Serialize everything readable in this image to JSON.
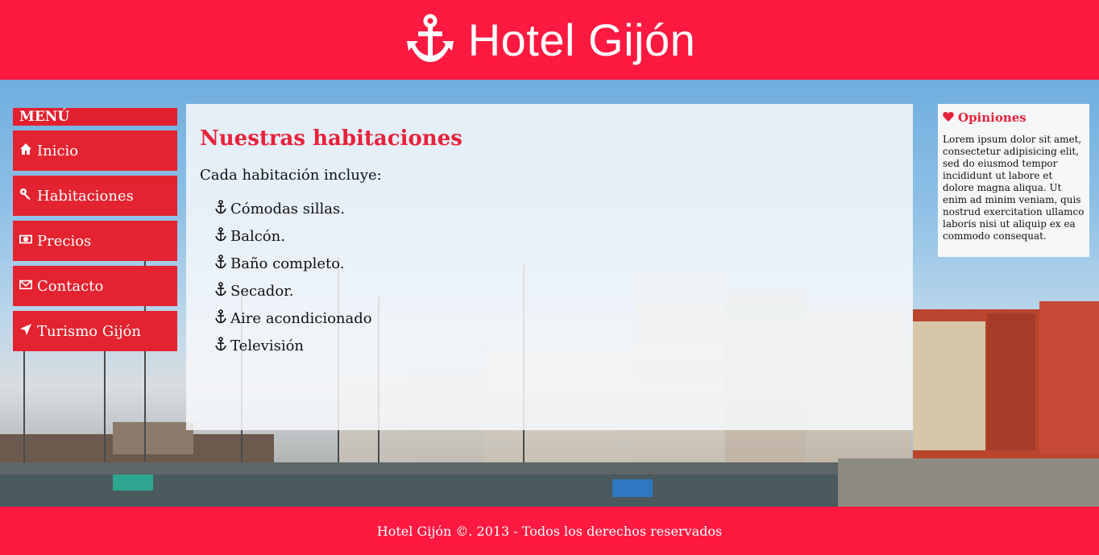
{
  "header": {
    "title": "Hotel Gijón",
    "logo_icon": "anchor-icon"
  },
  "menu": {
    "title": "MENÚ",
    "items": [
      {
        "label": "Inicio",
        "icon": "home-icon"
      },
      {
        "label": "Habitaciones",
        "icon": "key-icon"
      },
      {
        "label": "Precios",
        "icon": "money-icon"
      },
      {
        "label": "Contacto",
        "icon": "envelope-icon"
      },
      {
        "label": "Turismo Gijón",
        "icon": "location-arrow-icon"
      }
    ]
  },
  "main": {
    "title": "Nuestras habitaciones",
    "intro": "Cada habitación incluye:",
    "list": [
      "Cómodas sillas.",
      "Balcón.",
      "Baño completo.",
      "Secador.",
      "Aire acondicionado",
      "Televisión"
    ]
  },
  "aside": {
    "title": "Opiniones",
    "icon": "heart-icon",
    "text": "Lorem ipsum dolor sit amet, consectetur adipisicing elit, sed do eiusmod tempor incididunt ut labore et dolore magna aliqua. Ut enim ad minim veniam, quis nostrud exercitation ullamco laboris nisi ut aliquip ex ea commodo consequat."
  },
  "footer": {
    "text": "Hotel Gijón ©. 2013 - Todos los derechos reservados"
  },
  "colors": {
    "brand": "#fe1940",
    "menu": "#e3232f",
    "heading": "#e8213a"
  }
}
